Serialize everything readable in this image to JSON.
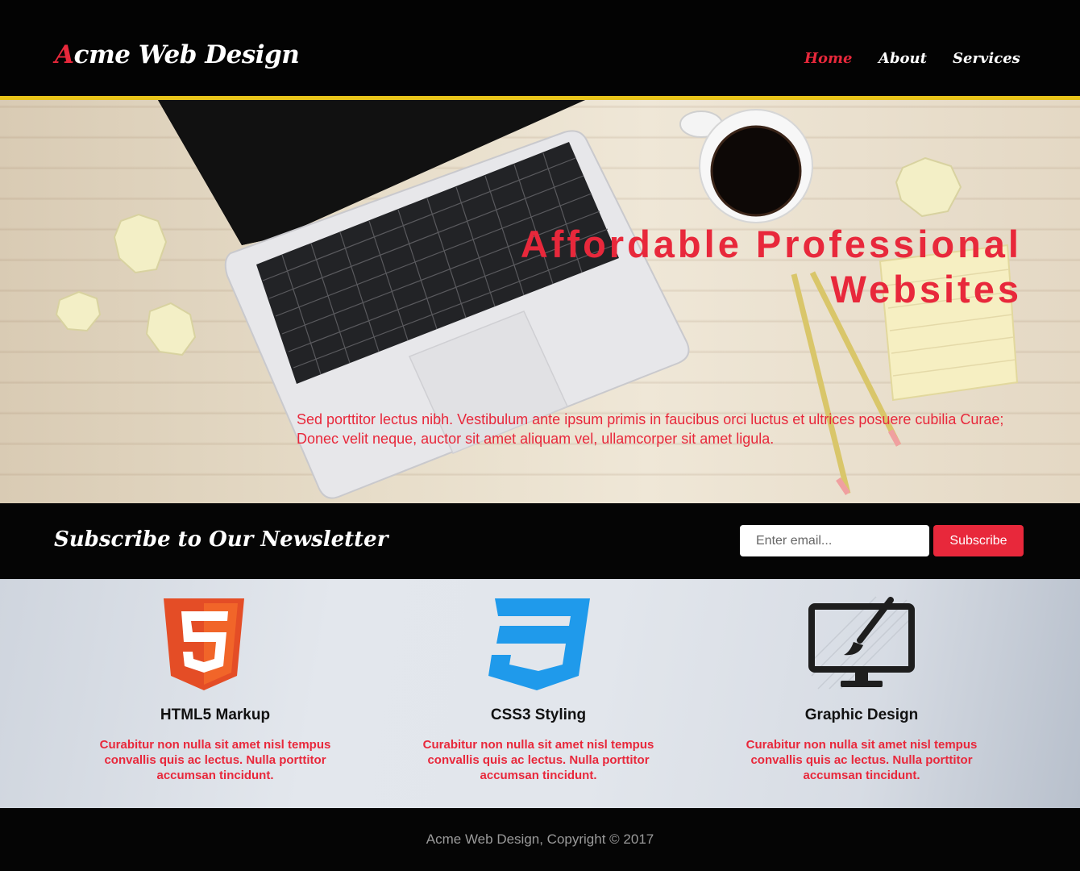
{
  "header": {
    "logo_first_letter": "A",
    "logo_rest": "cme Web Design",
    "nav": {
      "home": "Home",
      "about": "About",
      "services": "Services"
    }
  },
  "hero": {
    "title_line1": "Affordable Professional",
    "title_line2": "Websites",
    "text": "Sed porttitor lectus nibh. Vestibulum ante ipsum primis in faucibus orci luctus et ultrices posuere cubilia Curae; Donec velit neque, auctor sit amet aliquam vel, ullamcorper sit amet ligula."
  },
  "newsletter": {
    "title": "Subscribe to Our Newsletter",
    "email_placeholder": "Enter email...",
    "email_value": "",
    "button_label": "Subscribe"
  },
  "boxes": [
    {
      "icon": "html5-icon",
      "title": "HTML5 Markup",
      "text": "Curabitur non nulla sit amet nisl tempus convallis quis ac lectus. Nulla porttitor accumsan tincidunt."
    },
    {
      "icon": "css3-icon",
      "title": "CSS3 Styling",
      "text": "Curabitur non nulla sit amet nisl tempus convallis quis ac lectus. Nulla porttitor accumsan tincidunt."
    },
    {
      "icon": "graphic-design-icon",
      "title": "Graphic Design",
      "text": "Curabitur non nulla sit amet nisl tempus convallis quis ac lectus. Nulla porttitor accumsan tincidunt."
    }
  ],
  "footer": {
    "copyright": "Acme Web Design, Copyright © 2017"
  },
  "colors": {
    "accent": "#e8283b",
    "header_rule": "#e8c41a",
    "header_bg": "#030303",
    "html5_orange": "#e44d26",
    "css3_blue": "#1f9aeb"
  }
}
